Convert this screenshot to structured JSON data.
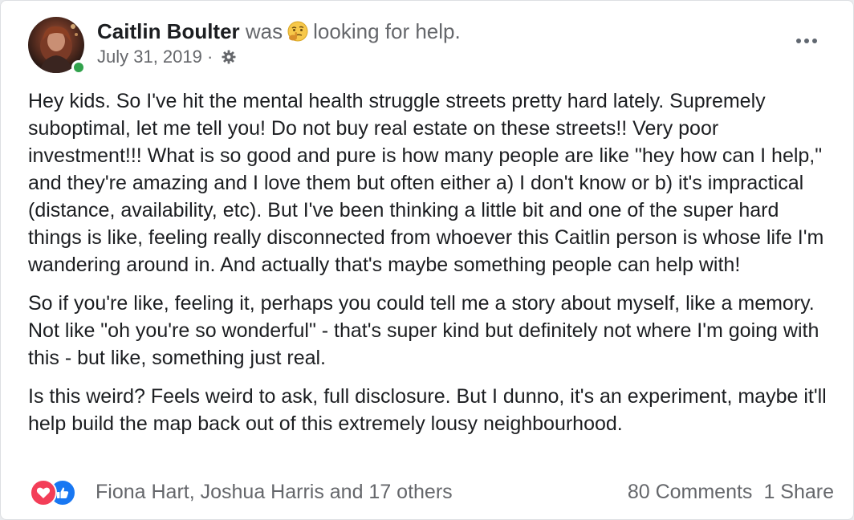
{
  "post": {
    "author": "Caitlin Boulter",
    "activity_prefix": "was",
    "activity_emoji": "thinking-face-icon",
    "activity_text": "looking for help.",
    "date": "July 31, 2019",
    "separator": "·",
    "audience_icon": "gear-icon",
    "paragraphs": [
      "Hey kids. So I've hit the mental health struggle streets pretty hard lately. Supremely suboptimal, let me tell you! Do not buy real estate on these streets!! Very poor investment!!! What is so good and pure is how many people are like \"hey how can I help,\" and they're amazing and I love them but often either a) I don't know or b) it's impractical (distance, availability, etc). But I've been thinking a little bit and one of the super hard things is like, feeling really disconnected from whoever this Caitlin person is whose life I'm wandering around in. And actually that's maybe something people can help with!",
      "So if you're like, feeling it, perhaps you could tell me a story about myself, like a memory. Not like \"oh you're so wonderful\" - that's super kind but definitely not where I'm going with this - but like, something just real.",
      "Is this weird? Feels weird to ask, full disclosure. But I dunno, it's an experiment, maybe it'll help build the map back out of this extremely lousy neighbourhood."
    ]
  },
  "footer": {
    "reaction_icons": [
      "love-icon",
      "like-icon"
    ],
    "reactors": "Fiona Hart, Joshua Harris and 17 others",
    "comments": "80 Comments",
    "shares": "1 Share"
  },
  "colors": {
    "text_primary": "#1c1e21",
    "text_secondary": "#65676b",
    "online": "#31a24c",
    "love": "#f33e58",
    "like": "#1877f2"
  }
}
